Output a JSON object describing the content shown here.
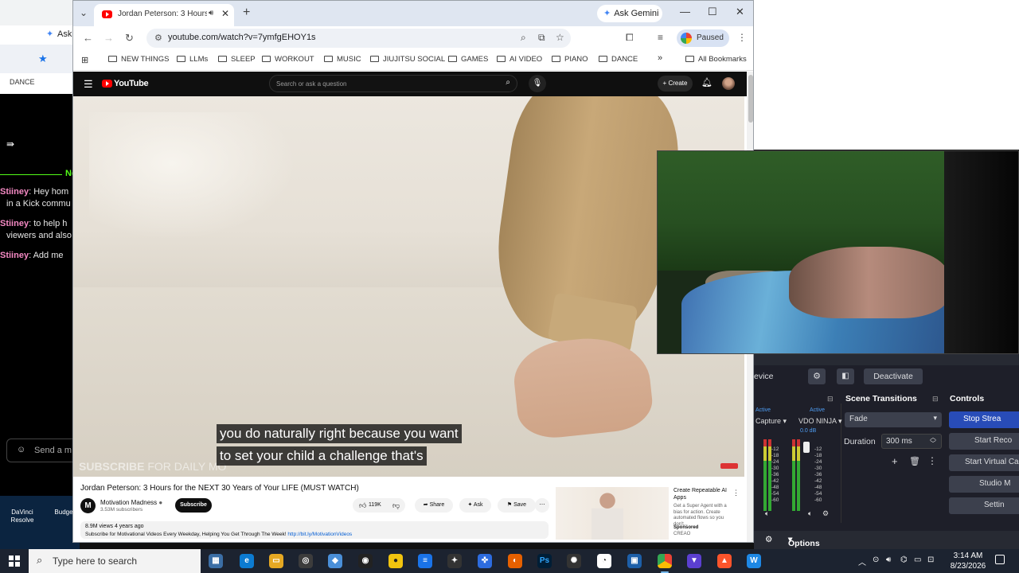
{
  "background_window": {
    "tab_label": "Ask",
    "bar_label": "DANCE",
    "chat": {
      "new_marker": "Ne",
      "lines": [
        {
          "user": "Stiiney",
          "text": ": Hey hom"
        },
        {
          "user": "",
          "text": "in a Kick commu"
        },
        {
          "user": "Stiiney",
          "text": ": to help h"
        },
        {
          "user": "",
          "text": "viewers and also"
        },
        {
          "user": "Stiiney",
          "text": ": Add me"
        }
      ],
      "send_placeholder": "Send a m"
    },
    "desktop_icons": [
      "DaVinci Resolve",
      "Budge"
    ]
  },
  "browser": {
    "tab_title": "Jordan Peterson: 3 Hours fo",
    "gemini_label": "Ask Gemini",
    "url": "youtube.com/watch?v=7ymfgEHOY1s",
    "profile_status": "Paused",
    "bookmarks": [
      "NEW THINGS",
      "LLMs",
      "SLEEP",
      "WORKOUT",
      "MUSIC",
      "JIUJITSU SOCIAL",
      "GAMES",
      "AI VIDEO",
      "PIANO",
      "DANCE"
    ],
    "overflow": "»",
    "all_bookmarks": "All Bookmarks"
  },
  "youtube": {
    "brand": "YouTube",
    "search_placeholder": "Search or ask a question",
    "create_label": "Create",
    "caption_lines": [
      "you do naturally right because you want",
      "to set your child a challenge that's"
    ],
    "overlay_text_bold": "SUBSCRIBE",
    "overlay_text_thin": "FOR DAILY MO",
    "video_title": "Jordan Peterson: 3 Hours for the NEXT 30 Years of Your LIFE (MUST WATCH)",
    "channel_initial": "M",
    "channel_name": "Motivation Madness",
    "channel_subs": "3.53M subscribers",
    "subscribe_label": "Subscribe",
    "likes": "119K",
    "share_label": "Share",
    "ask_label": "Ask",
    "save_label": "Save",
    "desc_meta": "8.9M views  4 years ago",
    "desc_text": "Subscribe for Motivational Videos Every Weekday, Helping You Get Through The Week! ",
    "desc_link": "http://bit.ly/MotivationVideos",
    "ad": {
      "title": "Create Repeatable AI Apps",
      "description": "Get a Super Agent with a bias for action. Create automated flows so you don't...",
      "sponsored": "Sponsored",
      "advertiser": "CREAO"
    }
  },
  "obs": {
    "scene_label": "evice",
    "deactivate_label": "Deactivate",
    "scene_transitions": "Scene Transitions",
    "controls": "Controls",
    "mixer": {
      "active1": "Active",
      "active2": "Active",
      "source1": "Capture",
      "source2": "VDO NINJA",
      "db": "0.0 dB",
      "scale": [
        "-12",
        "-18",
        "-24",
        "-30",
        "-36",
        "-42",
        "-48",
        "-54",
        "-60"
      ]
    },
    "transition": "Fade",
    "duration_label": "Duration",
    "duration_value": "300 ms",
    "buttons": [
      "Stop Strea",
      "Start Reco",
      "Start Virtual Ca",
      "Studio M",
      "Settin"
    ],
    "options_label": "Options"
  },
  "taskbar": {
    "search_placeholder": "Type here to search",
    "time": "3:14 AM",
    "date": "8/23/2026"
  },
  "colors": {
    "accent": "#284cb8",
    "youtube_red": "#ff0000",
    "chat_user": "#f58ac4",
    "kick_green": "#53fc18"
  }
}
